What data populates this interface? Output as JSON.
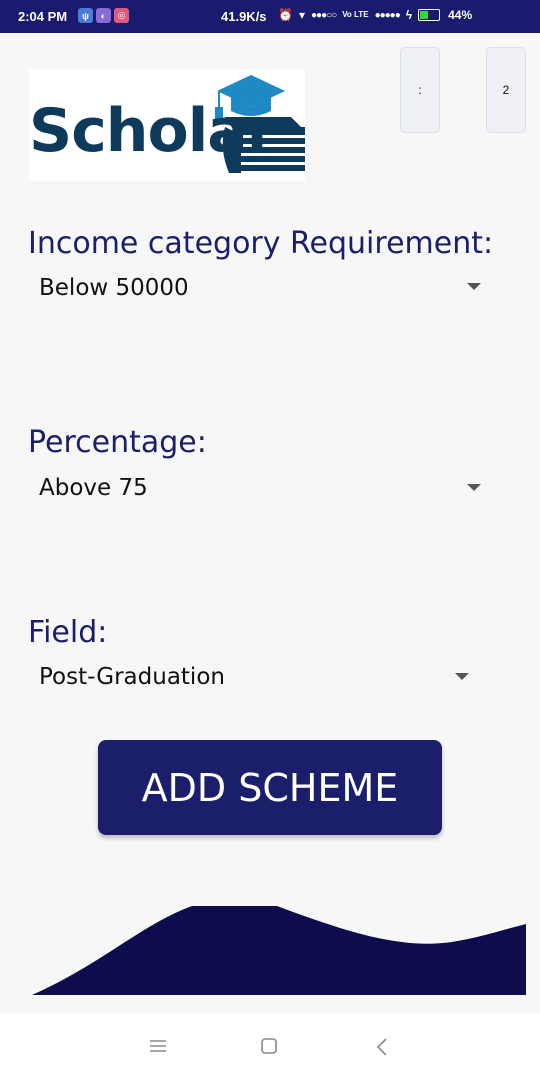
{
  "status_bar": {
    "time": "2:04 PM",
    "network_speed": "41.9K/s",
    "carrier_label": "Vo LTE",
    "battery_percent": "44%",
    "battery_level": 0.44
  },
  "logo": {
    "text": "Scholar"
  },
  "top_right_boxes": [
    ":",
    "2"
  ],
  "form": {
    "income_label": "Income category Requirement:",
    "income_value": "Below 50000",
    "percentage_label": "Percentage:",
    "percentage_value": "Above 75",
    "field_label": "Field:",
    "field_value": "Post-Graduation"
  },
  "add_button_label": "ADD SCHEME",
  "colors": {
    "primary": "#1b1f6b",
    "status_bar": "#1a1a6e",
    "wave": "#0d0d4d",
    "background": "#f7f7f8"
  },
  "icons": {
    "nav_menu": "menu-icon",
    "nav_home": "square-home-icon",
    "nav_back": "chevron-left-back-icon"
  }
}
